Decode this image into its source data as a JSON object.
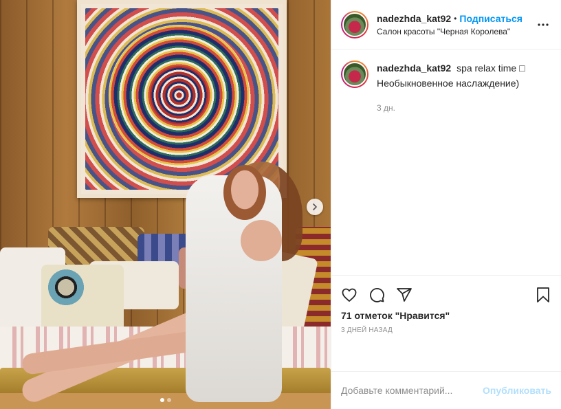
{
  "post": {
    "username": "nadezhda_kat92",
    "separator": "•",
    "follow_label": "Подписаться",
    "location": "Салон красоты \"Черная Королева\""
  },
  "caption": {
    "username": "nadezhda_kat92",
    "text": "spa relax time □ Необыкновенное наслаждение)",
    "time": "3 дн."
  },
  "actions": {
    "likes": "71 отметок \"Нравится\"",
    "date": "3 ДНЕЙ НАЗАД"
  },
  "comment": {
    "placeholder": "Добавьте комментарий...",
    "publish_label": "Опубликовать"
  },
  "carousel": {
    "slides": 2,
    "current": 1
  },
  "colors": {
    "accent": "#0095f6",
    "publish_disabled": "#b2dffc",
    "muted": "#8e8e8e",
    "text": "#262626"
  },
  "icons": {
    "more": "more-options-icon",
    "like": "heart-icon",
    "comment": "comment-icon",
    "share": "share-icon",
    "save": "bookmark-icon",
    "next": "chevron-right-icon"
  }
}
